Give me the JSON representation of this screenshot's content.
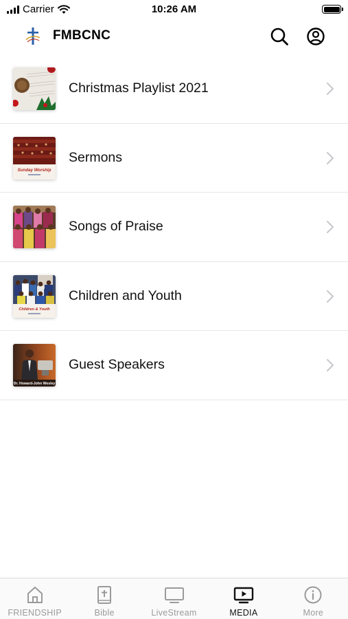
{
  "status_bar": {
    "carrier": "Carrier",
    "time": "10:26 AM"
  },
  "header": {
    "title": "FMBCNC",
    "logo_icon": "cross-logo-icon",
    "search_icon": "search-icon",
    "account_icon": "account-circle-icon"
  },
  "media": {
    "items": [
      {
        "label": "Christmas Playlist 2021",
        "thumb_icon": "christmas-thumbnail"
      },
      {
        "label": "Sermons",
        "thumb_icon": "sunday-worship-thumbnail",
        "thumb_caption": "Sunday Worship"
      },
      {
        "label": "Songs of Praise",
        "thumb_icon": "choir-thumbnail"
      },
      {
        "label": "Children and Youth",
        "thumb_icon": "children-youth-thumbnail",
        "thumb_caption": "Children & Youth"
      },
      {
        "label": "Guest Speakers",
        "thumb_icon": "guest-speaker-thumbnail",
        "thumb_caption": "Dr. Howard-John Wesley"
      }
    ]
  },
  "tab_bar": {
    "active_tab": "MEDIA",
    "tabs": [
      {
        "label": "FRIENDSHIP",
        "icon": "home-icon"
      },
      {
        "label": "Bible",
        "icon": "bible-icon"
      },
      {
        "label": "LiveStream",
        "icon": "monitor-icon"
      },
      {
        "label": "MEDIA",
        "icon": "play-video-icon"
      },
      {
        "label": "More",
        "icon": "info-icon"
      }
    ]
  },
  "colors": {
    "accent": "#111111",
    "inactive": "#9a9a9a",
    "divider": "#e6e6e6",
    "logo_blue": "#2a5fa8"
  }
}
